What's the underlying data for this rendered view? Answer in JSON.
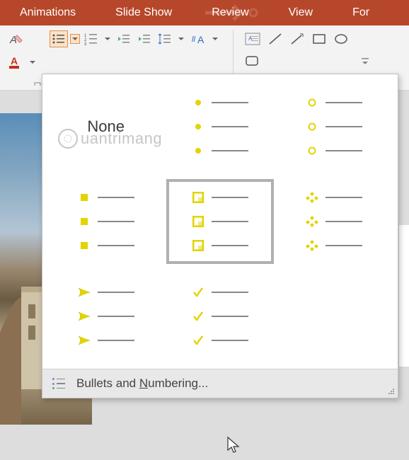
{
  "ribbon": {
    "tabs": [
      "Animations",
      "Slide Show",
      "Review",
      "View",
      "For"
    ]
  },
  "bullets": {
    "none_label": "None",
    "footer_prefix": "Bullets and ",
    "footer_underline": "N",
    "footer_suffix": "umbering..."
  },
  "watermark": {
    "text": "uantrimang"
  }
}
